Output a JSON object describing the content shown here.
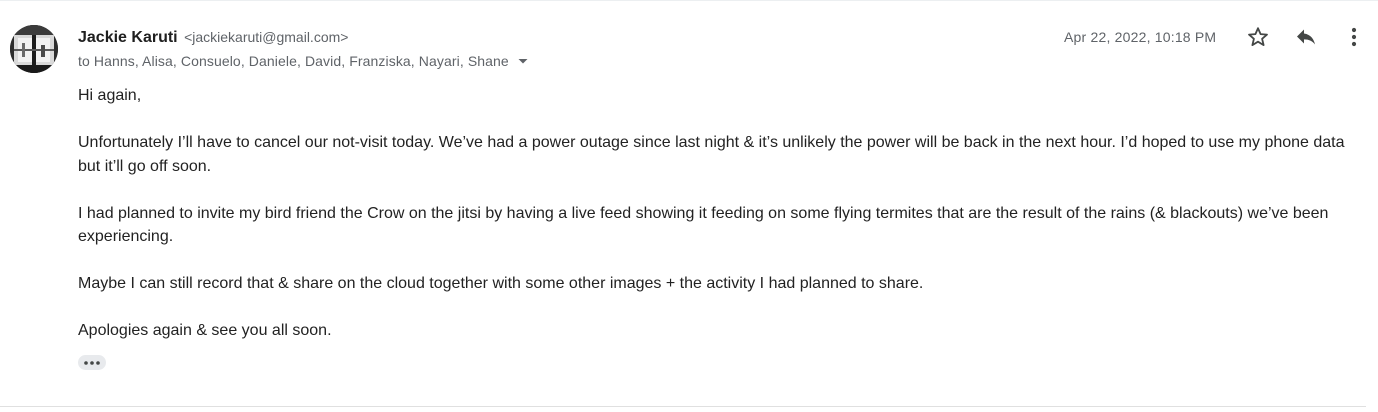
{
  "sender": {
    "name": "Jackie Karuti",
    "email": "<jackiekaruti@gmail.com>"
  },
  "recipients": "to Hanns, Alisa, Consuelo, Daniele, David, Franziska, Nayari, Shane",
  "date": "Apr 22, 2022, 10:18 PM",
  "icons": {
    "star": "star-outline-icon",
    "reply": "reply-icon",
    "more": "more-vertical-icon",
    "caret": "caret-down-icon",
    "trimmed": "ellipsis-icon"
  },
  "body": {
    "greeting": "Hi again,",
    "p1": "Unfortunately I’ll have to cancel our not-visit today. We’ve had a power outage since last night & it’s unlikely the power will be back in the next hour. I’d hoped to use my phone data but it’ll go off soon.",
    "p2": "I had planned to invite my bird friend the Crow on the jitsi by having a live feed showing it feeding on some flying termites that are the result of the rains (& blackouts) we’ve been experiencing.",
    "p3": "Maybe I can still record that & share on the cloud together with some other images + the activity I had planned to share.",
    "closing": "Apologies again & see you all soon."
  },
  "colors": {
    "meta_text": "#5f6368",
    "body_text": "#222222",
    "icon": "#444746",
    "chip_bg": "#e8eaed"
  }
}
